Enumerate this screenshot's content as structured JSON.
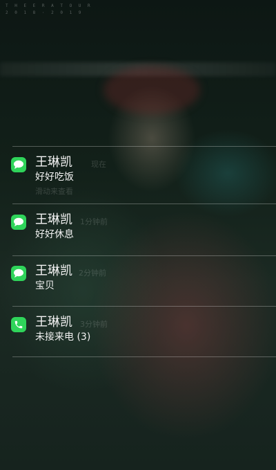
{
  "wallpaper": {
    "corner_text_line1": "T H E   E R A   T O U R",
    "corner_text_line2": "2 0 1 8 · 2 0 1 9"
  },
  "notifications": [
    {
      "app_icon": "messages-icon",
      "sender": "王琳凯",
      "message": "好好吃饭",
      "time_label": "现在",
      "hint": "滑动来查看"
    },
    {
      "app_icon": "messages-icon",
      "sender": "王琳凯",
      "message": "好好休息",
      "time_label": "1分钟前",
      "hint": ""
    },
    {
      "app_icon": "messages-icon",
      "sender": "王琳凯",
      "message": "宝贝",
      "time_label": "2分钟前",
      "hint": ""
    },
    {
      "app_icon": "phone-icon",
      "sender": "王琳凯",
      "message": "未接来电 (3)",
      "time_label": "3分钟前",
      "hint": ""
    }
  ],
  "colors": {
    "app_green": "#2fd45a",
    "text": "#f2f2f2"
  }
}
